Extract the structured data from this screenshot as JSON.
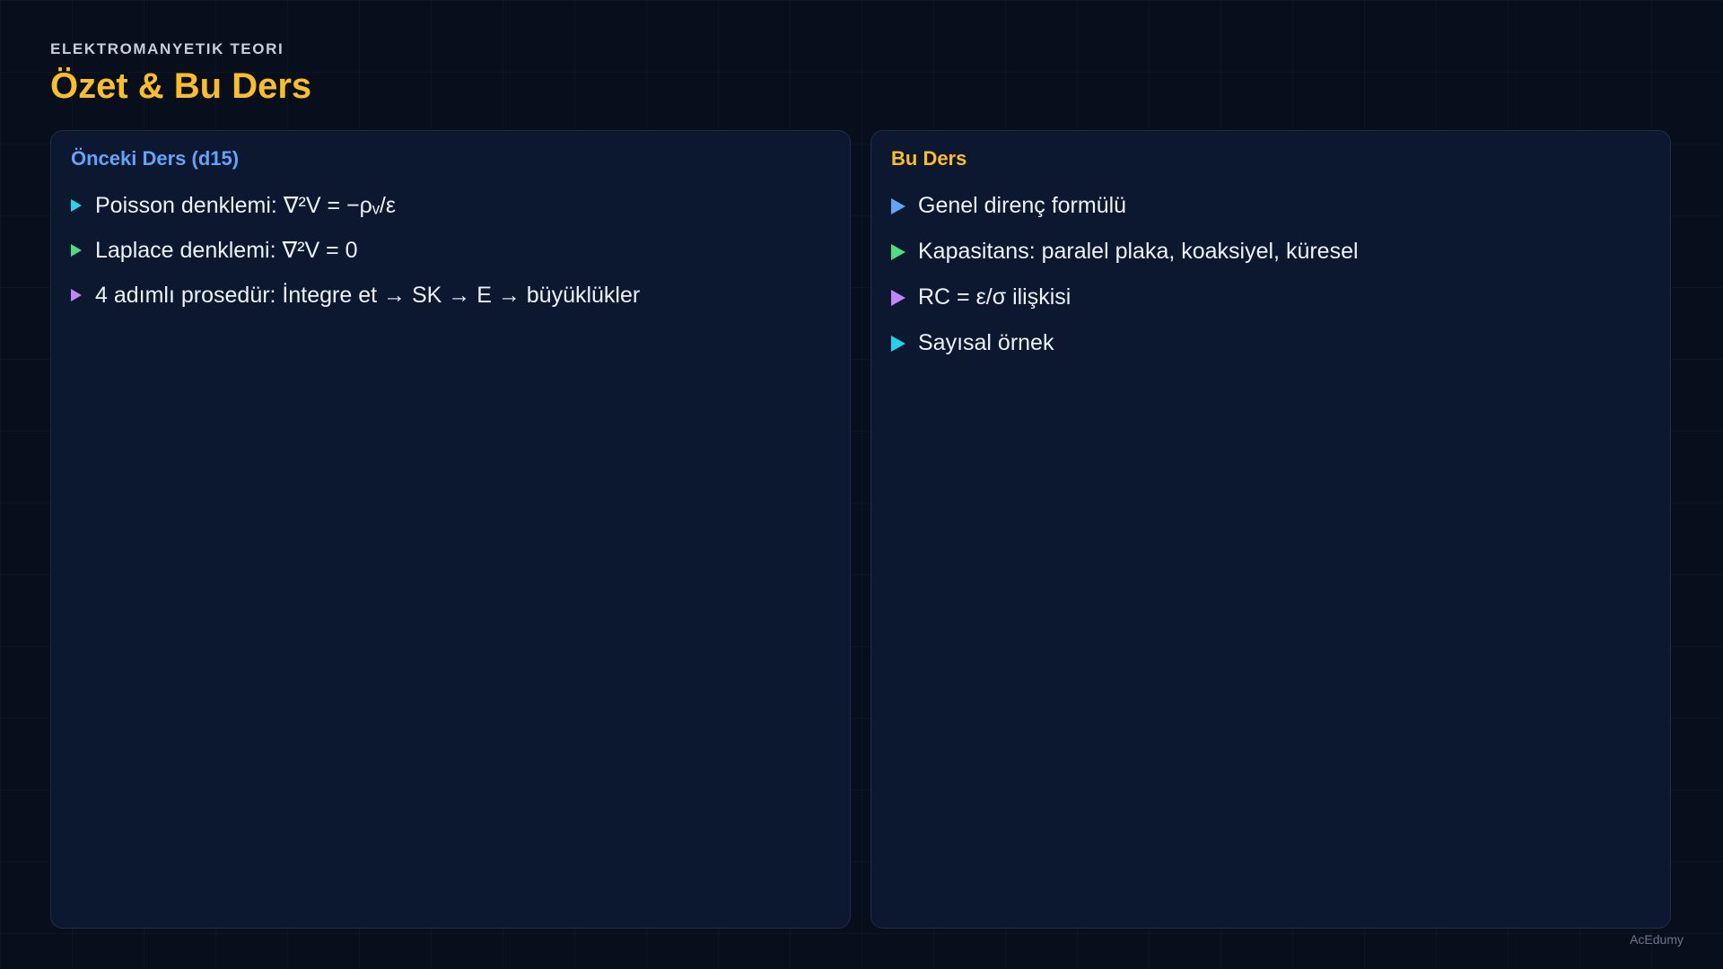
{
  "header": {
    "eyebrow": "ELEKTROMANYETIK TEORI",
    "title": "Özet & Bu Ders"
  },
  "left_panel": {
    "heading": "Önceki Ders (d15)",
    "items": [
      {
        "label": "Poisson denklemi: ∇²V = −ρᵥ/ε",
        "bullet_color": "#22d3ee"
      },
      {
        "label": "Laplace denklemi: ∇²V = 0",
        "bullet_color": "#4ade80"
      },
      {
        "label": "4 adımlı prosedür: İntegre et → SK → E → büyüklükler",
        "bullet_color": "#c084fc"
      }
    ]
  },
  "right_panel": {
    "heading": "Bu Ders",
    "items": [
      {
        "label": "Genel direnç formülü",
        "bullet_color": "#60a5fa"
      },
      {
        "label": "Kapasitans: paralel plaka, koaksiyel, küresel",
        "bullet_color": "#4ade80"
      },
      {
        "label": "RC = ε/σ ilişkisi",
        "bullet_color": "#c084fc"
      },
      {
        "label": "Sayısal örnek",
        "bullet_color": "#22d3ee"
      }
    ]
  },
  "footer": {
    "brand": "AcEdumy"
  },
  "colors": {
    "background": "#070f1d",
    "panel": "#0b1830",
    "accent_title": "#fbbf24",
    "accent_heading_left": "#60a5fa"
  }
}
